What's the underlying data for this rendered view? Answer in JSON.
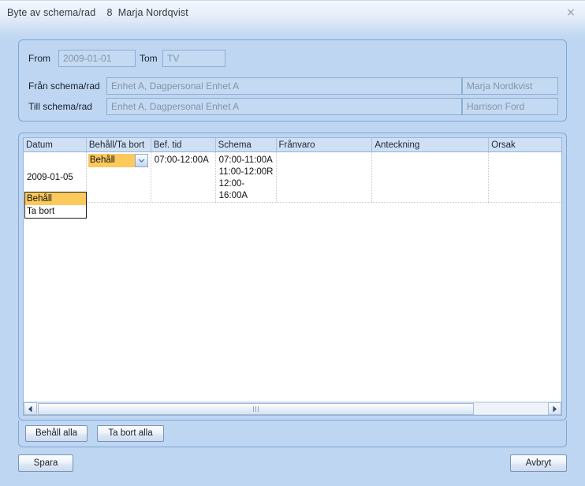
{
  "window": {
    "title": "Byte av schema/rad    8  Marja Nordqvist",
    "close_icon": "×"
  },
  "form": {
    "from_label": "From",
    "from_value": "2009-01-01",
    "tom_label": "Tom",
    "tom_value": "TV",
    "fran_label": "Från schema/rad",
    "fran_value": "Enhet A, Dagpersonal Enhet A",
    "fran_person": "Marja Nordkvist",
    "till_label": "Till schema/rad",
    "till_value": "Enhet A, Dagpersonal Enhet A",
    "till_person": "Harrison Ford"
  },
  "grid": {
    "columns": [
      {
        "label": "Datum",
        "width": 80
      },
      {
        "label": "Behåll/Ta bort",
        "width": 82
      },
      {
        "label": "Bef. tid",
        "width": 82
      },
      {
        "label": "Schema",
        "width": 77
      },
      {
        "label": "Frånvaro",
        "width": 122
      },
      {
        "label": "Anteckning",
        "width": 148
      },
      {
        "label": "Orsak",
        "width": 92
      }
    ],
    "rows": [
      {
        "datum": "2009-01-05",
        "behall": "Behåll",
        "bef_tid": "07:00-12:00A",
        "schema": "07:00-11:00A\n11:00-12:00R\n12:00-16:00A",
        "franvaro": "",
        "anteckning": "",
        "orsak": ""
      }
    ],
    "dropdown": {
      "open": true,
      "options": [
        "Behåll",
        "Ta bort"
      ],
      "selected": "Behåll"
    },
    "scrollbar": {
      "left_arrow": "◀",
      "right_arrow": "▶"
    }
  },
  "actions": {
    "keep_all": "Behåll alla",
    "remove_all": "Ta bort alla",
    "save": "Spara",
    "cancel": "Avbryt"
  },
  "colors": {
    "window_bg": "#bed6f2",
    "panel_border": "#7da7d4",
    "header_bg": "#cfe0f5",
    "highlight": "#fbc95c",
    "grid_bg": "#ffffff"
  }
}
